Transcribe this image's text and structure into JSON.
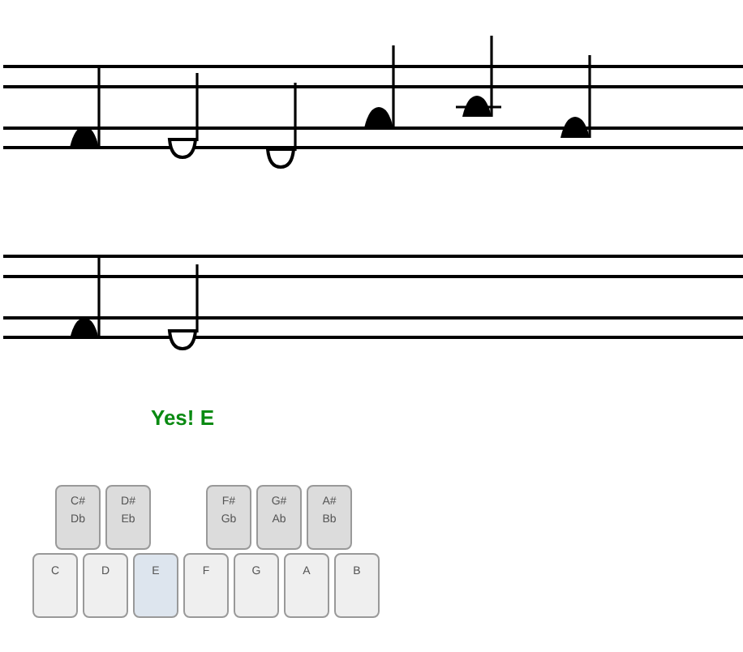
{
  "staves": [
    {
      "notes": [
        {
          "kind": "filled",
          "ledger": false
        },
        {
          "kind": "hollow",
          "ledger": false
        },
        {
          "kind": "hollow",
          "ledger": false
        },
        {
          "kind": "filled",
          "ledger": false
        },
        {
          "kind": "filled",
          "ledger": true
        },
        {
          "kind": "filled",
          "ledger": false
        }
      ]
    },
    {
      "notes": [
        {
          "kind": "filled",
          "ledger": false
        },
        {
          "kind": "hollow",
          "ledger": false
        }
      ]
    }
  ],
  "feedback": "Yes! E",
  "keys": [
    {
      "label": "C",
      "selected": false,
      "sharp": {
        "label": "C#",
        "alt": "Db",
        "selected": false
      }
    },
    {
      "label": "D",
      "selected": false,
      "sharp": {
        "label": "D#",
        "alt": "Eb",
        "selected": false
      }
    },
    {
      "label": "E",
      "selected": true
    },
    {
      "label": "F",
      "selected": false,
      "sharp": {
        "label": "F#",
        "alt": "Gb",
        "selected": false
      }
    },
    {
      "label": "G",
      "selected": false,
      "sharp": {
        "label": "G#",
        "alt": "Ab",
        "selected": false
      }
    },
    {
      "label": "A",
      "selected": false,
      "sharp": {
        "label": "A#",
        "alt": "Bb",
        "selected": false
      }
    },
    {
      "label": "B",
      "selected": false
    }
  ]
}
